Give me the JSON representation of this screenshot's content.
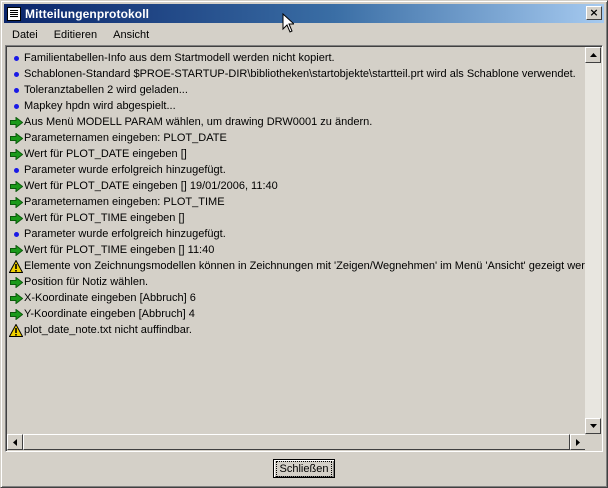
{
  "window": {
    "title": "Mitteilungenprotokoll",
    "close_glyph": "×"
  },
  "menu": [
    "Datei",
    "Editieren",
    "Ansicht"
  ],
  "log": [
    {
      "icon": "bullet-icon",
      "text": "Familientabellen-Info aus dem Startmodell werden nicht kopiert."
    },
    {
      "icon": "bullet-icon",
      "text": "Schablonen-Standard $PROE-STARTUP-DIR\\bibliotheken\\startobjekte\\startteil.prt wird als Schablone verwendet."
    },
    {
      "icon": "bullet-icon",
      "text": "Toleranztabellen 2 wird geladen..."
    },
    {
      "icon": "bullet-icon",
      "text": "Mapkey hpdn wird abgespielt..."
    },
    {
      "icon": "prompt-arrow-icon",
      "text": "Aus Menü MODELL PARAM wählen, um drawing DRW0001 zu ändern."
    },
    {
      "icon": "prompt-arrow-icon",
      "text": "Parameternamen eingeben: PLOT_DATE"
    },
    {
      "icon": "prompt-arrow-icon",
      "text": "Wert für PLOT_DATE eingeben []"
    },
    {
      "icon": "bullet-icon",
      "text": "Parameter wurde erfolgreich hinzugefügt."
    },
    {
      "icon": "prompt-arrow-icon",
      "text": "Wert für PLOT_DATE eingeben [] 19/01/2006, 11:40"
    },
    {
      "icon": "prompt-arrow-icon",
      "text": "Parameternamen eingeben: PLOT_TIME"
    },
    {
      "icon": "prompt-arrow-icon",
      "text": "Wert für PLOT_TIME eingeben []"
    },
    {
      "icon": "bullet-icon",
      "text": "Parameter wurde erfolgreich hinzugefügt."
    },
    {
      "icon": "prompt-arrow-icon",
      "text": "Wert für PLOT_TIME eingeben [] 11:40"
    },
    {
      "icon": "warning-icon",
      "text": "Elemente von Zeichnungsmodellen können in Zeichnungen mit 'Zeigen/Wegnehmen' im Menü 'Ansicht' gezeigt werden"
    },
    {
      "icon": "prompt-arrow-icon",
      "text": "Position für Notiz wählen."
    },
    {
      "icon": "prompt-arrow-icon",
      "text": "X-Koordinate eingeben [Abbruch] 6"
    },
    {
      "icon": "prompt-arrow-icon",
      "text": "Y-Koordinate eingeben [Abbruch] 4"
    },
    {
      "icon": "warning-icon",
      "text": "plot_date_note.txt nicht auffindbar."
    }
  ],
  "footer": {
    "close_button": "Schließen"
  },
  "colors": {
    "title_start": "#0a246a",
    "title_end": "#a6caf0",
    "bullet": "#1a1ae6",
    "arrow": "#1a9a1a",
    "warning": "#f0d000"
  }
}
